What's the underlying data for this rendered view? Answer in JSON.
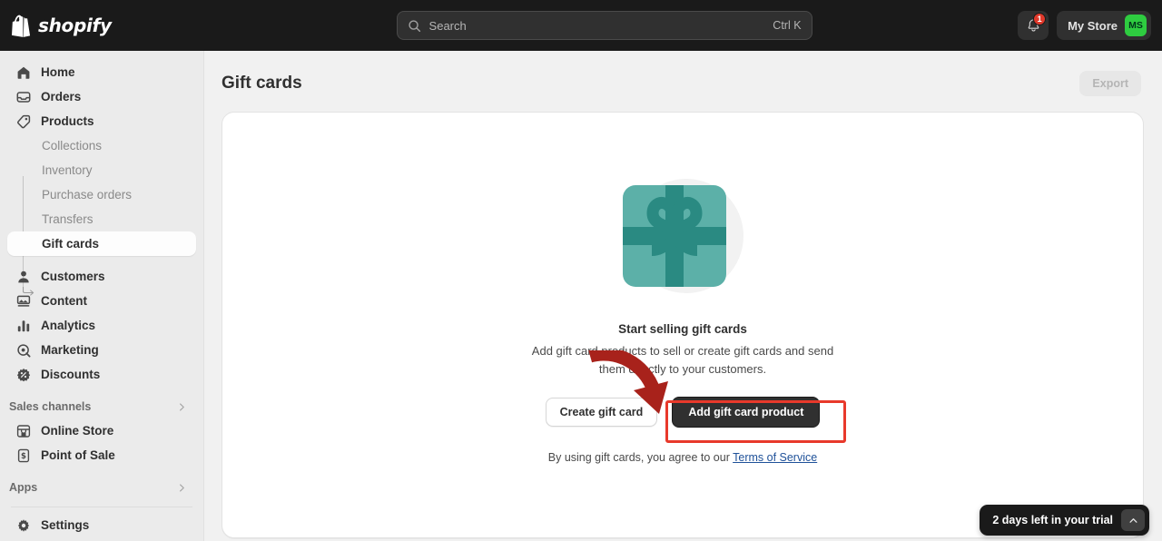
{
  "topbar": {
    "brand": "shopify",
    "brand_icon": "shopify-bag-icon",
    "search": {
      "placeholder": "Search",
      "shortcut": "Ctrl K",
      "icon": "search-icon"
    },
    "notifications": {
      "icon": "bell-icon",
      "badge": "1"
    },
    "store": {
      "name": "My Store",
      "avatar_initials": "MS",
      "avatar_color": "#2ecc40"
    }
  },
  "sidebar": {
    "items": [
      {
        "label": "Home",
        "icon": "home-icon"
      },
      {
        "label": "Orders",
        "icon": "orders-inbox-icon"
      },
      {
        "label": "Products",
        "icon": "product-tag-icon"
      },
      {
        "label": "Collections",
        "icon": "none"
      },
      {
        "label": "Inventory",
        "icon": "none"
      },
      {
        "label": "Purchase orders",
        "icon": "none"
      },
      {
        "label": "Transfers",
        "icon": "none"
      },
      {
        "label": "Gift cards",
        "icon": "branch-arrow-icon"
      },
      {
        "label": "Customers",
        "icon": "person-icon"
      },
      {
        "label": "Content",
        "icon": "content-image-icon"
      },
      {
        "label": "Analytics",
        "icon": "bar-chart-icon"
      },
      {
        "label": "Marketing",
        "icon": "megaphone-target-icon"
      },
      {
        "label": "Discounts",
        "icon": "discount-badge-icon"
      }
    ],
    "sales_channels": {
      "label": "Sales channels",
      "chevron": "chevron-right-icon",
      "items": [
        {
          "label": "Online Store",
          "icon": "storefront-icon"
        },
        {
          "label": "Point of Sale",
          "icon": "pos-terminal-icon"
        }
      ]
    },
    "apps": {
      "label": "Apps",
      "chevron": "chevron-right-icon"
    },
    "settings": {
      "label": "Settings",
      "icon": "gear-icon"
    }
  },
  "main": {
    "title": "Gift cards",
    "export_label": "Export",
    "empty_state": {
      "illustration": "gift-card-icon",
      "illustration_colors": {
        "light_teal": "#5cb0a8",
        "dark_teal": "#2a8a82",
        "backdrop": "#f2f2f2"
      },
      "title": "Start selling gift cards",
      "description": "Add gift card products to sell or create gift cards and send them directly to your customers.",
      "secondary_button": "Create gift card",
      "primary_button": "Add gift card product",
      "terms_prefix": "By using gift cards, you agree to our ",
      "terms_link": "Terms of Service"
    }
  },
  "annotations": {
    "arrow": {
      "name": "pointer-arrow",
      "color": "#a8221b",
      "points_to": "Add gift card product"
    },
    "highlight_box": {
      "name": "highlight-rectangle",
      "color": "#e8392b",
      "targets": "Add gift card product"
    }
  },
  "trial_banner": {
    "text": "2 days left in your trial",
    "toggle_icon": "chevron-up-icon"
  }
}
